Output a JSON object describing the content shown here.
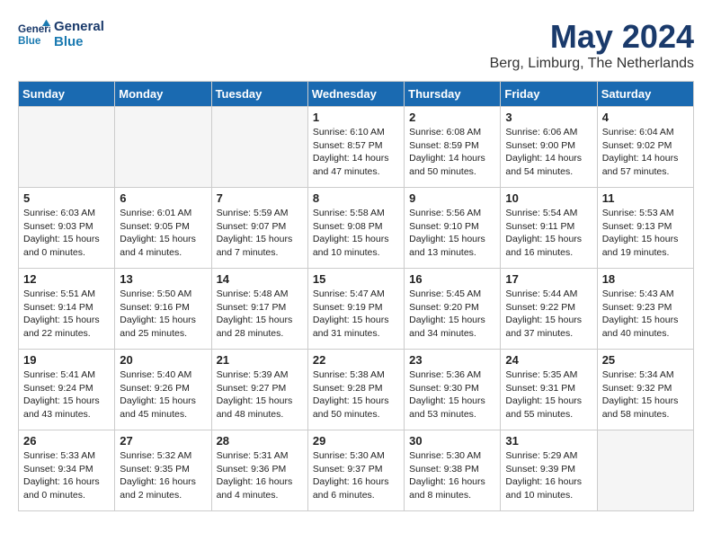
{
  "header": {
    "logo_line1": "General",
    "logo_line2": "Blue",
    "month": "May 2024",
    "location": "Berg, Limburg, The Netherlands"
  },
  "days_of_week": [
    "Sunday",
    "Monday",
    "Tuesday",
    "Wednesday",
    "Thursday",
    "Friday",
    "Saturday"
  ],
  "weeks": [
    [
      {
        "day": "",
        "info": "",
        "empty": true
      },
      {
        "day": "",
        "info": "",
        "empty": true
      },
      {
        "day": "",
        "info": "",
        "empty": true
      },
      {
        "day": "1",
        "info": "Sunrise: 6:10 AM\nSunset: 8:57 PM\nDaylight: 14 hours\nand 47 minutes."
      },
      {
        "day": "2",
        "info": "Sunrise: 6:08 AM\nSunset: 8:59 PM\nDaylight: 14 hours\nand 50 minutes."
      },
      {
        "day": "3",
        "info": "Sunrise: 6:06 AM\nSunset: 9:00 PM\nDaylight: 14 hours\nand 54 minutes."
      },
      {
        "day": "4",
        "info": "Sunrise: 6:04 AM\nSunset: 9:02 PM\nDaylight: 14 hours\nand 57 minutes."
      }
    ],
    [
      {
        "day": "5",
        "info": "Sunrise: 6:03 AM\nSunset: 9:03 PM\nDaylight: 15 hours\nand 0 minutes."
      },
      {
        "day": "6",
        "info": "Sunrise: 6:01 AM\nSunset: 9:05 PM\nDaylight: 15 hours\nand 4 minutes."
      },
      {
        "day": "7",
        "info": "Sunrise: 5:59 AM\nSunset: 9:07 PM\nDaylight: 15 hours\nand 7 minutes."
      },
      {
        "day": "8",
        "info": "Sunrise: 5:58 AM\nSunset: 9:08 PM\nDaylight: 15 hours\nand 10 minutes."
      },
      {
        "day": "9",
        "info": "Sunrise: 5:56 AM\nSunset: 9:10 PM\nDaylight: 15 hours\nand 13 minutes."
      },
      {
        "day": "10",
        "info": "Sunrise: 5:54 AM\nSunset: 9:11 PM\nDaylight: 15 hours\nand 16 minutes."
      },
      {
        "day": "11",
        "info": "Sunrise: 5:53 AM\nSunset: 9:13 PM\nDaylight: 15 hours\nand 19 minutes."
      }
    ],
    [
      {
        "day": "12",
        "info": "Sunrise: 5:51 AM\nSunset: 9:14 PM\nDaylight: 15 hours\nand 22 minutes."
      },
      {
        "day": "13",
        "info": "Sunrise: 5:50 AM\nSunset: 9:16 PM\nDaylight: 15 hours\nand 25 minutes."
      },
      {
        "day": "14",
        "info": "Sunrise: 5:48 AM\nSunset: 9:17 PM\nDaylight: 15 hours\nand 28 minutes."
      },
      {
        "day": "15",
        "info": "Sunrise: 5:47 AM\nSunset: 9:19 PM\nDaylight: 15 hours\nand 31 minutes."
      },
      {
        "day": "16",
        "info": "Sunrise: 5:45 AM\nSunset: 9:20 PM\nDaylight: 15 hours\nand 34 minutes."
      },
      {
        "day": "17",
        "info": "Sunrise: 5:44 AM\nSunset: 9:22 PM\nDaylight: 15 hours\nand 37 minutes."
      },
      {
        "day": "18",
        "info": "Sunrise: 5:43 AM\nSunset: 9:23 PM\nDaylight: 15 hours\nand 40 minutes."
      }
    ],
    [
      {
        "day": "19",
        "info": "Sunrise: 5:41 AM\nSunset: 9:24 PM\nDaylight: 15 hours\nand 43 minutes."
      },
      {
        "day": "20",
        "info": "Sunrise: 5:40 AM\nSunset: 9:26 PM\nDaylight: 15 hours\nand 45 minutes."
      },
      {
        "day": "21",
        "info": "Sunrise: 5:39 AM\nSunset: 9:27 PM\nDaylight: 15 hours\nand 48 minutes."
      },
      {
        "day": "22",
        "info": "Sunrise: 5:38 AM\nSunset: 9:28 PM\nDaylight: 15 hours\nand 50 minutes."
      },
      {
        "day": "23",
        "info": "Sunrise: 5:36 AM\nSunset: 9:30 PM\nDaylight: 15 hours\nand 53 minutes."
      },
      {
        "day": "24",
        "info": "Sunrise: 5:35 AM\nSunset: 9:31 PM\nDaylight: 15 hours\nand 55 minutes."
      },
      {
        "day": "25",
        "info": "Sunrise: 5:34 AM\nSunset: 9:32 PM\nDaylight: 15 hours\nand 58 minutes."
      }
    ],
    [
      {
        "day": "26",
        "info": "Sunrise: 5:33 AM\nSunset: 9:34 PM\nDaylight: 16 hours\nand 0 minutes."
      },
      {
        "day": "27",
        "info": "Sunrise: 5:32 AM\nSunset: 9:35 PM\nDaylight: 16 hours\nand 2 minutes."
      },
      {
        "day": "28",
        "info": "Sunrise: 5:31 AM\nSunset: 9:36 PM\nDaylight: 16 hours\nand 4 minutes."
      },
      {
        "day": "29",
        "info": "Sunrise: 5:30 AM\nSunset: 9:37 PM\nDaylight: 16 hours\nand 6 minutes."
      },
      {
        "day": "30",
        "info": "Sunrise: 5:30 AM\nSunset: 9:38 PM\nDaylight: 16 hours\nand 8 minutes."
      },
      {
        "day": "31",
        "info": "Sunrise: 5:29 AM\nSunset: 9:39 PM\nDaylight: 16 hours\nand 10 minutes."
      },
      {
        "day": "",
        "info": "",
        "empty": true
      }
    ]
  ]
}
